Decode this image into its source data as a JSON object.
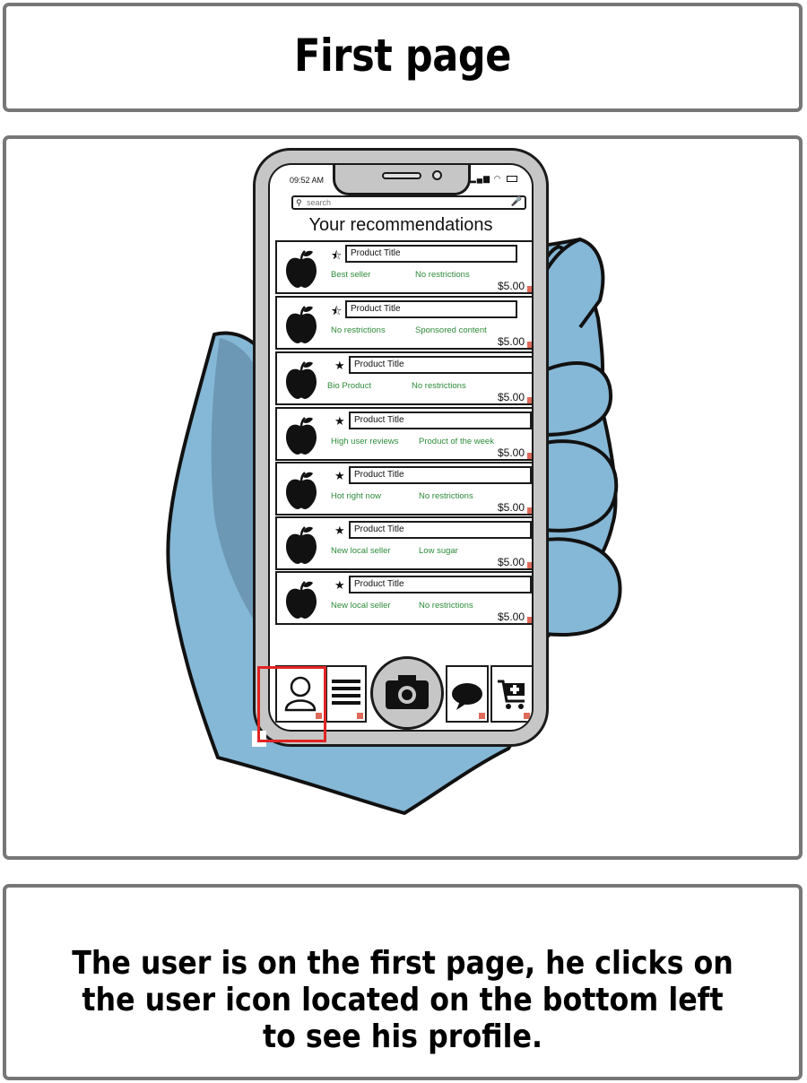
{
  "title": "First page",
  "caption": "The user is on the first page, he clicks on the user icon located on the bottom left to see his profile.",
  "phone": {
    "status_time": "09:52 AM",
    "search_placeholder": "search",
    "heading": "Your recommendations",
    "items": [
      {
        "title": "Product Title",
        "tag1": "Best seller",
        "tag2": "No restrictions",
        "price": "$5.00",
        "star": "half"
      },
      {
        "title": "Product Title",
        "tag1": "No restrictions",
        "tag2": "Sponsored content",
        "price": "$5.00",
        "star": "half"
      },
      {
        "title": "Product Title",
        "tag1": "Bio Product",
        "tag2": "No restrictions",
        "price": "$5.00",
        "star": "full"
      },
      {
        "title": "Product Title",
        "tag1": "High user reviews",
        "tag2": "Product of the week",
        "price": "$5.00",
        "star": "full"
      },
      {
        "title": "Product Title",
        "tag1": "Hot right now",
        "tag2": "No restrictions",
        "price": "$5.00",
        "star": "full"
      },
      {
        "title": "Product Title",
        "tag1": "New local seller",
        "tag2": "Low sugar",
        "price": "$5.00",
        "star": "full"
      },
      {
        "title": "Product Title",
        "tag1": "New local seller",
        "tag2": "No restrictions",
        "price": "$5.00",
        "star": "full"
      }
    ],
    "nav": [
      "user-icon",
      "list-icon",
      "camera-icon",
      "chat-icon",
      "cart-add-icon"
    ]
  },
  "colors": {
    "hand": "#85b7d6",
    "tag_green": "#2e8b3a",
    "highlight": "#e02424",
    "corner_marker": "#e06a5a"
  }
}
